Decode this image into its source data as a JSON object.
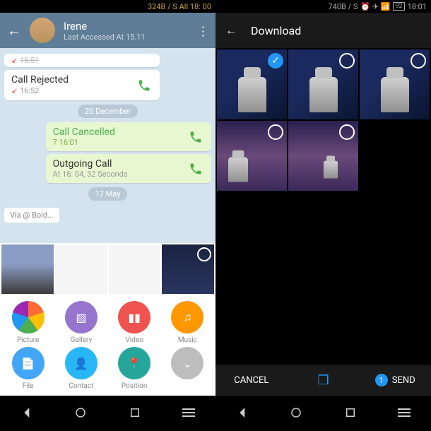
{
  "left": {
    "status": "324B / S All 18: 00",
    "contact_name": "Irene",
    "last_accessed": "Last Accessed At 15.11",
    "messages": [
      {
        "type": "in",
        "title": "",
        "time": "16:51",
        "icon": "missed"
      },
      {
        "type": "in",
        "title": "Call Rejected",
        "time": "16:52",
        "icon": "missed",
        "call": true
      },
      {
        "type": "date",
        "label": "20 December"
      },
      {
        "type": "out",
        "title": "Call Cancelled",
        "time": "7 16:01",
        "call": true
      },
      {
        "type": "out",
        "title": "Outgoing Call",
        "time": "At 16: 04, 32 Seconds",
        "call": true
      },
      {
        "type": "date",
        "label": "17 May"
      }
    ],
    "via_text": "Via @ Bold...",
    "attach_options": [
      {
        "id": "picture",
        "label": "Picture"
      },
      {
        "id": "gallery",
        "label": "Gallery"
      },
      {
        "id": "video",
        "label": "Video"
      },
      {
        "id": "music",
        "label": "Music"
      },
      {
        "id": "file",
        "label": "File"
      },
      {
        "id": "contact",
        "label": "Contact"
      },
      {
        "id": "position",
        "label": "Position"
      },
      {
        "id": "more",
        "label": ""
      }
    ]
  },
  "right": {
    "status": "740B / S",
    "time": "18:01",
    "battery": "92",
    "title": "Download",
    "images_selected": [
      true,
      false,
      false,
      false,
      false
    ],
    "cancel": "CANCEL",
    "send": "SEND",
    "selected_count": "1"
  }
}
